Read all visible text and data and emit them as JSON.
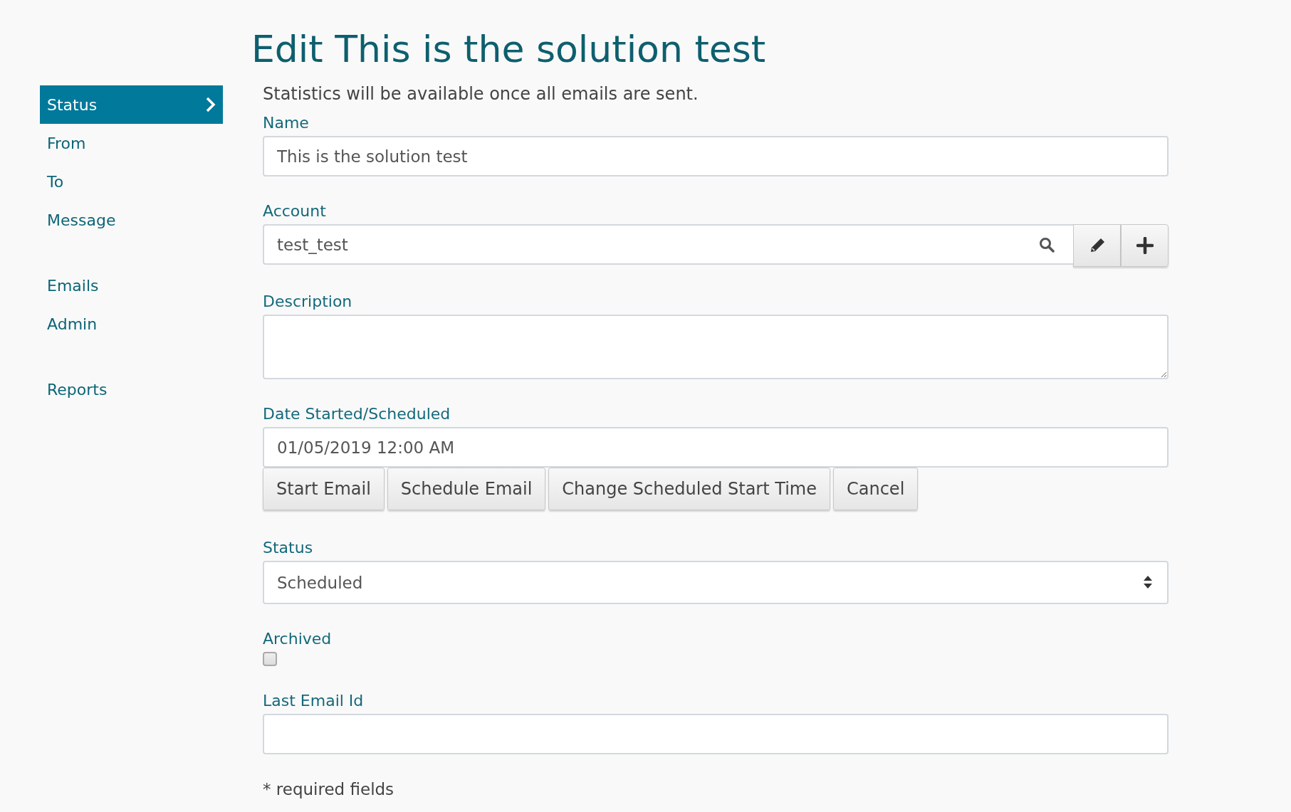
{
  "sidebar": {
    "groups": [
      [
        {
          "label": "Status",
          "selected": true
        },
        {
          "label": "From",
          "selected": false
        },
        {
          "label": "To",
          "selected": false
        },
        {
          "label": "Message",
          "selected": false
        }
      ],
      [
        {
          "label": "Emails",
          "selected": false
        },
        {
          "label": "Admin",
          "selected": false
        }
      ],
      [
        {
          "label": "Reports",
          "selected": false
        }
      ]
    ]
  },
  "page": {
    "title": "Edit This is the solution test",
    "notice": "Statistics will be available once all emails are sent."
  },
  "fields": [
    {
      "kind": "text",
      "label": "Name",
      "value": "This is the solution test"
    },
    {
      "kind": "lookup",
      "label": "Account",
      "value": "test_test"
    },
    {
      "kind": "textarea",
      "label": "Description"
    },
    {
      "kind": "datetime",
      "label": "Date Started/Scheduled",
      "value": "01/05/2019 12:00 AM",
      "buttons": [
        "Start Email",
        "Schedule Email",
        "Change Scheduled Start Time",
        "Cancel"
      ]
    },
    {
      "kind": "select",
      "label": "Status",
      "value": "Scheduled"
    },
    {
      "kind": "checkbox",
      "label": "Archived",
      "checked": false
    },
    {
      "kind": "text",
      "label": "Last Email Id"
    }
  ],
  "footer_note": "* required fields"
}
